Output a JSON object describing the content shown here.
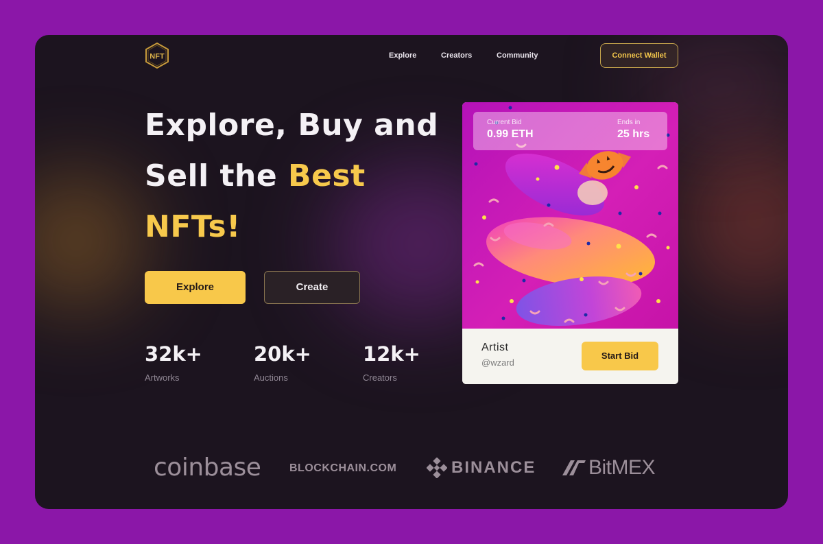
{
  "brand": {
    "logo_text": "NFT",
    "logo_color": "#c79a3a"
  },
  "nav": {
    "links": [
      "Explore",
      "Creators",
      "Community"
    ],
    "connect_label": "Connect Wallet"
  },
  "hero": {
    "line1": "Explore, Buy and",
    "line2_plain": "Sell the ",
    "line2_highlight": "Best",
    "line3": "NFTs!"
  },
  "actions": {
    "explore_label": "Explore",
    "create_label": "Create"
  },
  "stats": [
    {
      "value": "32k+",
      "label": "Artworks"
    },
    {
      "value": "20k+",
      "label": "Auctions"
    },
    {
      "value": "12k+",
      "label": "Creators"
    }
  ],
  "card": {
    "bid_label": "Current Bid",
    "bid_value": "0.99 ETH",
    "ends_label": "Ends in",
    "ends_value": "25 hrs",
    "artist_label": "Artist",
    "artist_handle": "@wzard",
    "start_bid_label": "Start Bid"
  },
  "partners": {
    "coinbase": "coinbase",
    "blockchain": "BLOCKCHAIN.COM",
    "binance": "BINANCE",
    "bitmex": "BitMEX"
  },
  "colors": {
    "accent": "#f8c84a",
    "background": "#8b17a8",
    "panel": "#1c141f"
  }
}
